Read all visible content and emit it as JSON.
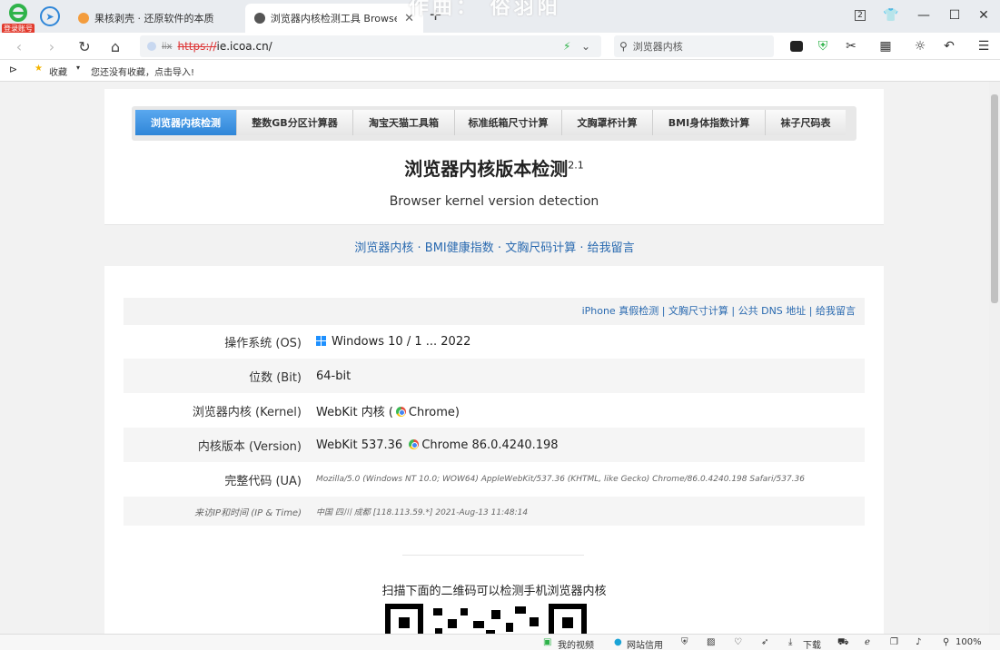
{
  "browser": {
    "login_badge": "登录账号",
    "tabs": [
      {
        "label": "果核剥壳 · 还原软件的本质",
        "active": false
      },
      {
        "label": "浏览器内核检测工具 Browser k",
        "active": true
      }
    ],
    "tab_count": "2",
    "url_prefix": "https://",
    "url_host": "ie.icoa.cn/",
    "url_badge": "iix",
    "search_text": "浏览器内核",
    "bookmarks_label": "收藏",
    "bookmarks_hint": "您还没有收藏，点击导入!",
    "watermark": "作曲：  俗羽阳"
  },
  "page": {
    "nav_tabs": [
      {
        "label": "浏览器内核检测",
        "active": true
      },
      {
        "label": "整数GB分区计算器",
        "active": false
      },
      {
        "label": "淘宝天猫工具箱",
        "active": false
      },
      {
        "label": "标准纸箱尺寸计算",
        "active": false
      },
      {
        "label": "文胸罩杯计算",
        "active": false
      },
      {
        "label": "BMI身体指数计算",
        "active": false
      },
      {
        "label": "袜子尺码表",
        "active": false
      }
    ],
    "title": "浏览器内核版本检测",
    "title_version": "2.1",
    "subtitle": "Browser kernel version detection",
    "links": [
      "浏览器内核",
      "BMI健康指数",
      "文胸尺码计算",
      "给我留言"
    ],
    "link_sep": " · ",
    "info_links": [
      "iPhone 真假检测",
      "文胸尺寸计算",
      "公共 DNS 地址",
      "给我留言"
    ],
    "info_sep": " | ",
    "rows": [
      {
        "label": "操作系统 (OS)",
        "value": "Windows 10 / 1 ... 2022"
      },
      {
        "label": "位数 (Bit)",
        "value": "64-bit"
      },
      {
        "label": "浏览器内核 (Kernel)",
        "value_pre": "WebKit 内核 (",
        "value_post": "Chrome)"
      },
      {
        "label": "内核版本 (Version)",
        "value_pre": "WebKit 537.36 ",
        "value_post": "Chrome 86.0.4240.198"
      },
      {
        "label": "完整代码 (UA)",
        "value": "Mozilla/5.0 (Windows NT 10.0; WOW64) AppleWebKit/537.36 (KHTML, like Gecko) Chrome/86.0.4240.198 Safari/537.36"
      },
      {
        "label": "来访IP和时间 (IP & Time)",
        "value": "中国 四川 成都 [118.113.59.*]    2021-Aug-13 11:48:14"
      }
    ],
    "qr_title": "扫描下面的二维码可以检测手机浏览器内核"
  },
  "statusbar": {
    "video": "我的视频",
    "trust": "网站信用",
    "download": "下载",
    "zoom": "100%"
  },
  "colors": {
    "accent": "#2f86d8",
    "link": "#2a6ab0"
  }
}
